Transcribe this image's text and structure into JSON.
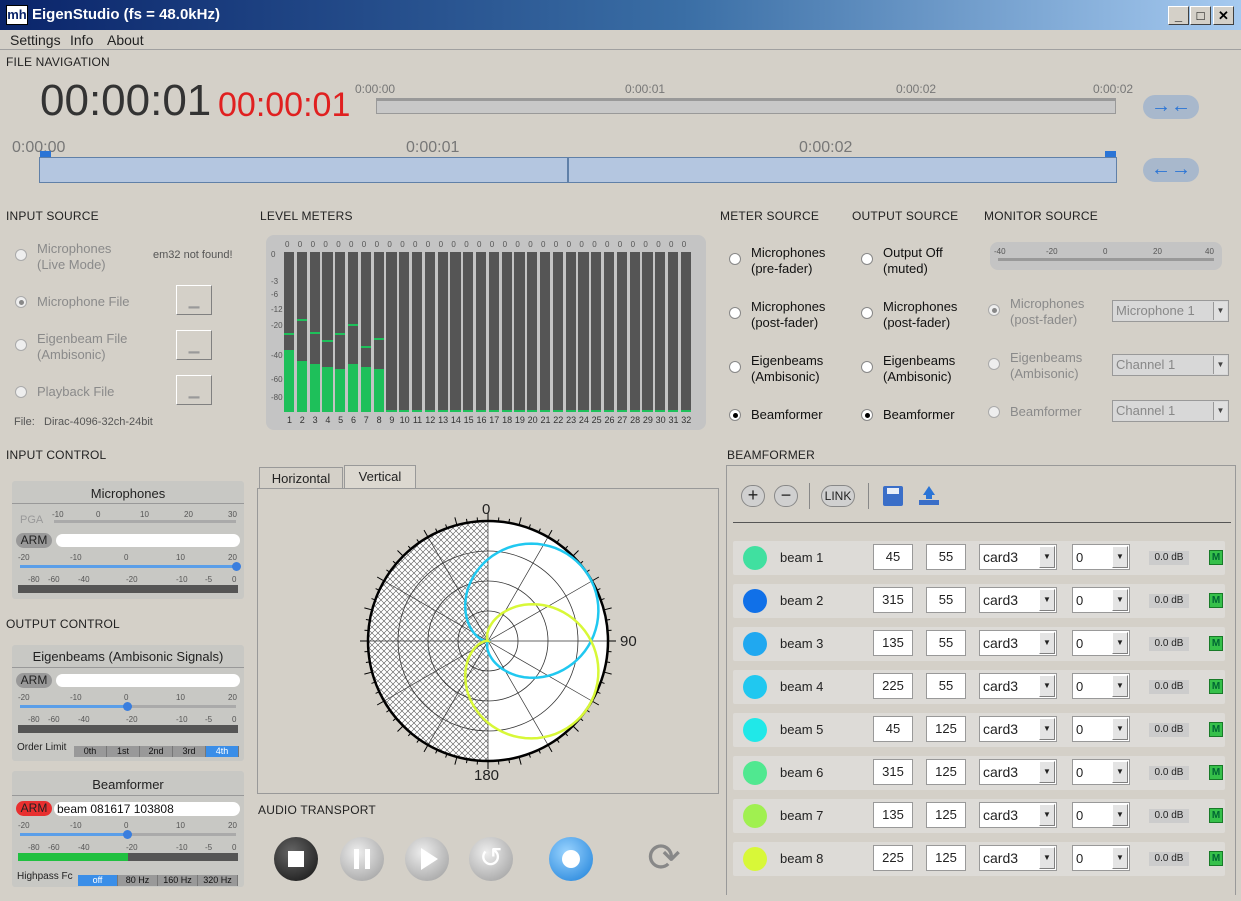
{
  "window": {
    "title": "EigenStudio (fs = 48.0kHz)",
    "icon": "mh-logo-icon",
    "buttons": [
      "_",
      "□",
      "✕"
    ]
  },
  "menu": [
    "Settings",
    "Info",
    "About"
  ],
  "file_navigation": {
    "heading": "FILE NAVIGATION",
    "time_current": "00:00:01",
    "time_red": "00:00:01",
    "top_ticks": [
      "0:00:00",
      "0:00:01",
      "0:00:02",
      "0:00:02"
    ],
    "bottom_ticks": [
      "0:00:00",
      "0:00:01",
      "0:00:02"
    ],
    "zoom_in_icon": "arrows-inward-icon",
    "zoom_out_icon": "arrows-outward-icon",
    "playhead_position": 0.49
  },
  "input_source": {
    "heading": "INPUT SOURCE",
    "options": [
      {
        "label1": "Microphones",
        "label2": "(Live Mode)",
        "selected": false,
        "enabled": false
      },
      {
        "label1": "Microphone File",
        "label2": "",
        "selected": true,
        "enabled": false
      },
      {
        "label1": "Eigenbeam File",
        "label2": "(Ambisonic)",
        "selected": false,
        "enabled": false
      },
      {
        "label1": "Playback File",
        "label2": "",
        "selected": false,
        "enabled": false
      }
    ],
    "em32_status": "em32 not found!",
    "file_label": "File:",
    "file_name": "Dirac-4096-32ch-24bit"
  },
  "level_meters": {
    "heading": "LEVEL METERS",
    "scale": [
      "0",
      "-3",
      "-6",
      "-12",
      "-20",
      "-40",
      "-60",
      "-80"
    ],
    "peak_values": [
      "0",
      "0",
      "0",
      "0",
      "0",
      "0",
      "0",
      "0",
      "0",
      "0",
      "0",
      "0",
      "0",
      "0",
      "0",
      "0",
      "0",
      "0",
      "0",
      "0",
      "0",
      "0",
      "0",
      "0",
      "0",
      "0",
      "0",
      "0",
      "0",
      "0",
      "0",
      "0"
    ],
    "channels": [
      "1",
      "2",
      "3",
      "4",
      "5",
      "6",
      "7",
      "8",
      "9",
      "10",
      "11",
      "12",
      "13",
      "14",
      "15",
      "16",
      "17",
      "18",
      "19",
      "20",
      "21",
      "22",
      "23",
      "24",
      "25",
      "26",
      "27",
      "28",
      "29",
      "30",
      "31",
      "32"
    ],
    "levels": [
      0.39,
      0.32,
      0.3,
      0.28,
      0.27,
      0.3,
      0.28,
      0.27,
      0.01,
      0.01,
      0.01,
      0.01,
      0.01,
      0.01,
      0.01,
      0.01,
      0.01,
      0.01,
      0.01,
      0.01,
      0.01,
      0.01,
      0.01,
      0.01,
      0.01,
      0.01,
      0.01,
      0.01,
      0.01,
      0.01,
      0.01,
      0.01
    ],
    "peaks": [
      0.48,
      0.57,
      0.49,
      0.44,
      0.48,
      0.54,
      0.4,
      0.45
    ]
  },
  "meter_source": {
    "heading": "METER SOURCE",
    "options": [
      {
        "label1": "Microphones",
        "label2": "(pre-fader)",
        "selected": false
      },
      {
        "label1": "Microphones",
        "label2": "(post-fader)",
        "selected": false
      },
      {
        "label1": "Eigenbeams",
        "label2": "(Ambisonic)",
        "selected": false
      },
      {
        "label1": "Beamformer",
        "label2": "",
        "selected": true
      }
    ]
  },
  "output_source": {
    "heading": "OUTPUT SOURCE",
    "options": [
      {
        "label1": "Output Off",
        "label2": "(muted)",
        "selected": false
      },
      {
        "label1": "Microphones",
        "label2": "(post-fader)",
        "selected": false
      },
      {
        "label1": "Eigenbeams",
        "label2": "(Ambisonic)",
        "selected": false
      },
      {
        "label1": "Beamformer",
        "label2": "",
        "selected": true
      }
    ]
  },
  "monitor_source": {
    "heading": "MONITOR SOURCE",
    "scale": [
      "-40",
      "-20",
      "0",
      "20",
      "40"
    ],
    "options": [
      {
        "label1": "Microphones",
        "label2": "(post-fader)",
        "selected": true,
        "combo": "Microphone 1"
      },
      {
        "label1": "Eigenbeams",
        "label2": "(Ambisonic)",
        "selected": false,
        "combo": "Channel 1"
      },
      {
        "label1": "Beamformer",
        "label2": "",
        "selected": false,
        "combo": "Channel 1"
      }
    ]
  },
  "input_control": {
    "heading": "INPUT CONTROL",
    "panel_title": "Microphones",
    "pga_label": "PGA",
    "pga_scale": [
      "-10",
      "0",
      "10",
      "20",
      "30"
    ],
    "arm_label": "ARM",
    "gain_scale": [
      "-20",
      "-10",
      "0",
      "10",
      "20"
    ],
    "meter_scale": [
      "-80",
      "-60",
      "-40",
      "-20",
      "-10",
      "-5",
      "0"
    ],
    "gain_value": 20
  },
  "output_control": {
    "heading": "OUTPUT CONTROL",
    "eigen_panel_title": "Eigenbeams (Ambisonic Signals)",
    "arm_label": "ARM",
    "gain_scale": [
      "-20",
      "-10",
      "0",
      "10",
      "20"
    ],
    "meter_scale": [
      "-80",
      "-60",
      "-40",
      "-20",
      "-10",
      "-5",
      "0"
    ],
    "order_limit_label": "Order Limit",
    "orders": [
      "0th",
      "1st",
      "2nd",
      "3rd",
      "4th"
    ],
    "order_selected": 4,
    "beamformer_panel_title": "Beamformer",
    "beam_arm_label": "ARM",
    "beam_name": "beam  081617  103808",
    "highpass_label": "Highpass Fc",
    "highpass_options": [
      "off",
      "80 Hz",
      "160 Hz",
      "320 Hz"
    ],
    "highpass_selected": 0,
    "beam_level": 0.5
  },
  "polar_plot": {
    "tabs": [
      "Horizontal",
      "Vertical"
    ],
    "active_tab": 1,
    "label_top": "0",
    "label_right": "90",
    "label_bottom": "180"
  },
  "audio_transport": {
    "heading": "AUDIO TRANSPORT",
    "buttons": [
      "stop-icon",
      "pause-icon",
      "play-icon",
      "rewind-icon",
      "record-icon",
      "loop-icon"
    ]
  },
  "beamformer": {
    "heading": "BEAMFORMER",
    "toolbar": {
      "add": "+",
      "remove": "−",
      "link": "LINK",
      "save_icon": "floppy-disk-icon",
      "load_icon": "upload-icon"
    },
    "beams": [
      {
        "name": "beam 1",
        "az": "45",
        "el": "55",
        "pattern": "card3",
        "param": "0",
        "gain": "0.0 dB",
        "color": "#40e0a0",
        "mute": "M"
      },
      {
        "name": "beam 2",
        "az": "315",
        "el": "55",
        "pattern": "card3",
        "param": "0",
        "gain": "0.0 dB",
        "color": "#1070e8",
        "mute": "M"
      },
      {
        "name": "beam 3",
        "az": "135",
        "el": "55",
        "pattern": "card3",
        "param": "0",
        "gain": "0.0 dB",
        "color": "#20a8f0",
        "mute": "M"
      },
      {
        "name": "beam 4",
        "az": "225",
        "el": "55",
        "pattern": "card3",
        "param": "0",
        "gain": "0.0 dB",
        "color": "#20c8f0",
        "mute": "M"
      },
      {
        "name": "beam 5",
        "az": "45",
        "el": "125",
        "pattern": "card3",
        "param": "0",
        "gain": "0.0 dB",
        "color": "#20e8e8",
        "mute": "M"
      },
      {
        "name": "beam 6",
        "az": "315",
        "el": "125",
        "pattern": "card3",
        "param": "0",
        "gain": "0.0 dB",
        "color": "#50e890",
        "mute": "M"
      },
      {
        "name": "beam 7",
        "az": "135",
        "el": "125",
        "pattern": "card3",
        "param": "0",
        "gain": "0.0 dB",
        "color": "#a0f050",
        "mute": "M"
      },
      {
        "name": "beam 8",
        "az": "225",
        "el": "125",
        "pattern": "card3",
        "param": "0",
        "gain": "0.0 dB",
        "color": "#d8f838",
        "mute": "M"
      }
    ]
  }
}
